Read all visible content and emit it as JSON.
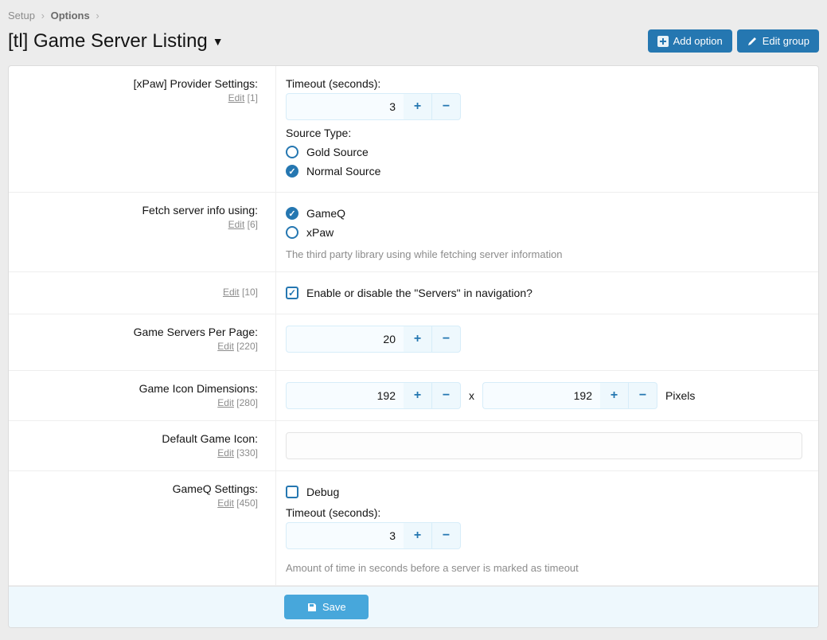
{
  "breadcrumb": {
    "setup": "Setup",
    "options": "Options"
  },
  "page_title": "[tl] Game Server Listing",
  "buttons": {
    "add_option": "Add option",
    "edit_group": "Edit group",
    "save": "Save"
  },
  "edit_label": "Edit",
  "rows": {
    "provider": {
      "label": "[xPaw] Provider Settings:",
      "order": "[1]",
      "timeout_label": "Timeout (seconds):",
      "timeout_value": "3",
      "source_type_label": "Source Type:",
      "opt_gold": "Gold Source",
      "opt_normal": "Normal Source"
    },
    "fetch": {
      "label": "Fetch server info using:",
      "order": "[6]",
      "opt_gameq": "GameQ",
      "opt_xpaw": "xPaw",
      "help": "The third party library using while fetching server information"
    },
    "nav": {
      "order": "[10]",
      "checkbox_label": "Enable or disable the \"Servers\" in navigation?"
    },
    "perpage": {
      "label": "Game Servers Per Page:",
      "order": "[220]",
      "value": "20"
    },
    "icondim": {
      "label": "Game Icon Dimensions:",
      "order": "[280]",
      "w": "192",
      "h": "192",
      "x": "x",
      "unit": "Pixels"
    },
    "defaulticon": {
      "label": "Default Game Icon:",
      "order": "[330]",
      "value": ""
    },
    "gameq": {
      "label": "GameQ Settings:",
      "order": "[450]",
      "debug_label": "Debug",
      "timeout_label": "Timeout (seconds):",
      "timeout_value": "3",
      "help": "Amount of time in seconds before a server is marked as timeout"
    }
  }
}
